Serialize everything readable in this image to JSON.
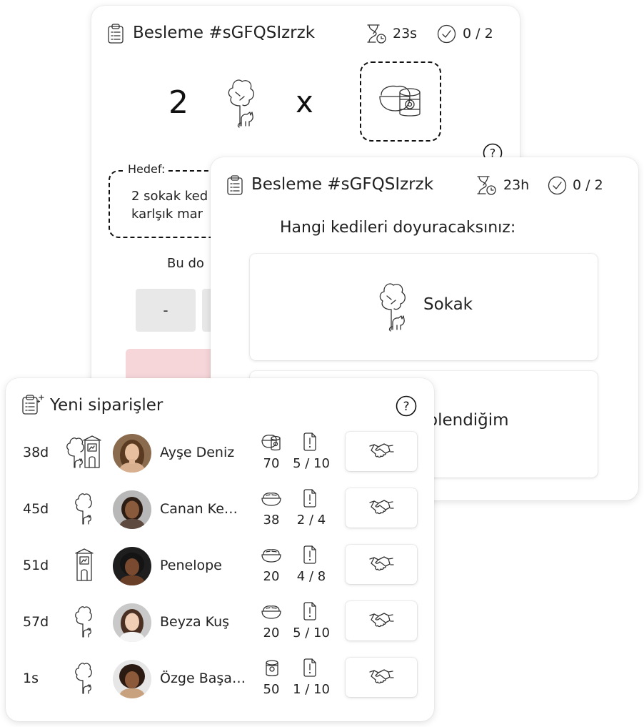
{
  "feeding_card_back": {
    "title": "Besleme #sGFQSIzrzk",
    "time_left": "23s",
    "progress": "0 / 2",
    "quantity": "2",
    "multiply_sign": "x",
    "help_label": "?",
    "goal_legend": "Hedef:",
    "goal_line1": "2 sokak ked",
    "goal_line2": "karlşık mar",
    "partial_text": "Bu do",
    "minus_label": "-",
    "icons": {
      "cat": "street-cat-icon",
      "food": "mixed-food-icon"
    }
  },
  "feeding_card_front": {
    "title": "Besleme #sGFQSIzrzk",
    "time_left": "23h",
    "progress": "0 / 2",
    "question": "Hangi kedileri doyuracaksınız:",
    "options": [
      {
        "label": "Sokak",
        "icon": "street-cat-icon"
      },
      {
        "label": "olendiğim",
        "icon": ""
      }
    ]
  },
  "orders_card": {
    "title": "Yeni siparişler",
    "help_label": "?",
    "rows": [
      {
        "age": "38d",
        "cat_type": "street-and-shelter",
        "name": "Ayşe Deniz",
        "food": "mixed-food",
        "quantity": "70",
        "slots": "5 / 10"
      },
      {
        "age": "45d",
        "cat_type": "street",
        "name": "Canan Ke…",
        "food": "dry-food",
        "quantity": "38",
        "slots": "2 / 4"
      },
      {
        "age": "51d",
        "cat_type": "shelter",
        "name": "Penelope",
        "food": "dry-food",
        "quantity": "20",
        "slots": "4 / 8"
      },
      {
        "age": "57d",
        "cat_type": "street",
        "name": "Beyza Kuş",
        "food": "dry-food",
        "quantity": "20",
        "slots": "5 / 10"
      },
      {
        "age": "1s",
        "cat_type": "street",
        "name": "Özge Başa…",
        "food": "can-food",
        "quantity": "50",
        "slots": "1 / 10"
      }
    ]
  },
  "colors": {
    "accent_pink": "#f6d6d9",
    "button_grey": "#e8e8e8",
    "text": "#222222"
  }
}
